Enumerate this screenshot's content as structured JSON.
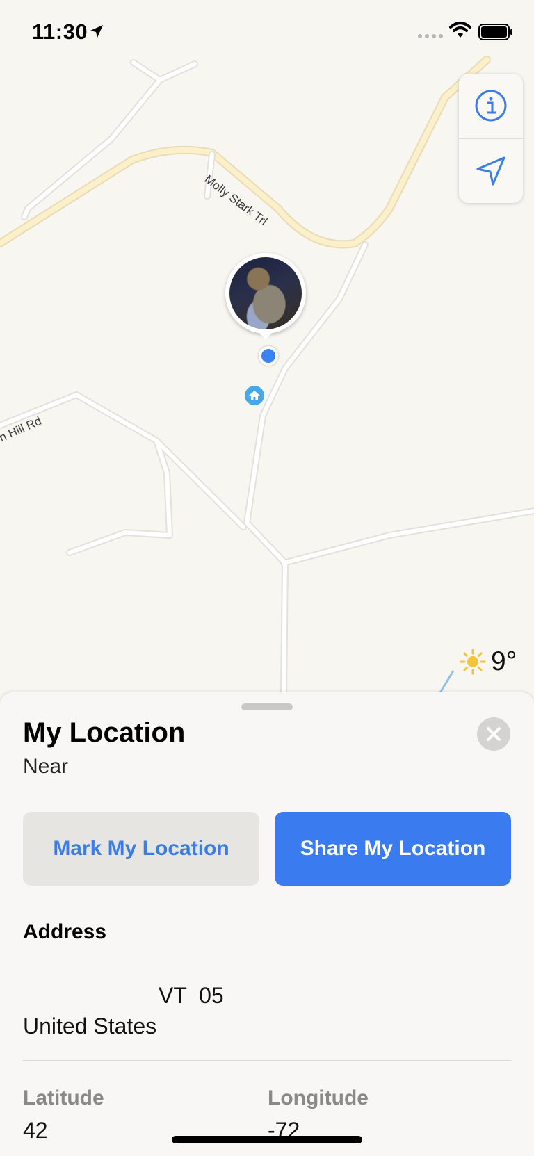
{
  "status_bar": {
    "time": "11:30"
  },
  "map": {
    "road_labels": [
      "Molly Stark Trl",
      "n Hill Rd"
    ],
    "weather": {
      "temperature": "9°",
      "icon": "sun-icon"
    },
    "controls": [
      {
        "icon": "info-icon"
      },
      {
        "icon": "location-arrow-icon"
      }
    ],
    "colors": {
      "land": "#f8f6f1",
      "road": "#ffffff",
      "highway": "#f7e7b5",
      "accent": "#3a82f0"
    }
  },
  "sheet": {
    "title": "My Location",
    "subtitle": "Near",
    "buttons": {
      "mark": "Mark My Location",
      "share": "Share My Location"
    },
    "address": {
      "label": "Address",
      "line1": "VT  05",
      "line2": "United States"
    },
    "latitude": {
      "label": "Latitude",
      "value": "42"
    },
    "longitude": {
      "label": "Longitude",
      "value": "-72"
    }
  }
}
